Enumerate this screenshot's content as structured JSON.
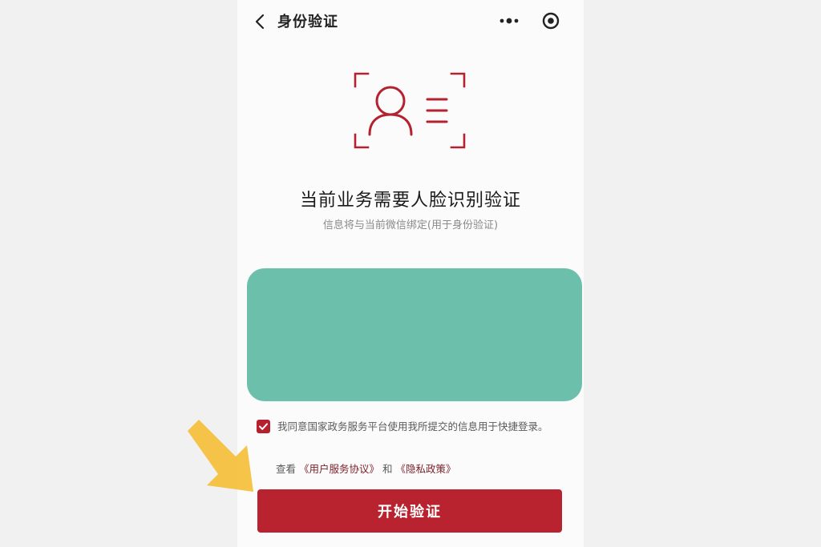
{
  "header": {
    "title": "身份验证",
    "back_icon": "chevron-left-icon",
    "more_icon": "more-dots-icon",
    "close_icon": "target-circle-icon"
  },
  "hero": {
    "icon": "face-scan-icon",
    "headline": "当前业务需要人脸识别验证",
    "subline": "信息将与当前微信绑定(用于身份验证)"
  },
  "agreement": {
    "checked": true,
    "text": "我同意国家政务服务平台使用我所提交的信息用于快捷登录。",
    "prefix": "查看",
    "user_agreement": "《用户服务协议》",
    "and": "和",
    "privacy_policy": "《隐私政策》"
  },
  "actions": {
    "start_label": "开始验证"
  },
  "colors": {
    "primary": "#b8232f",
    "redaction": "#6bbfab",
    "annotation_arrow": "#f4bf3a"
  }
}
